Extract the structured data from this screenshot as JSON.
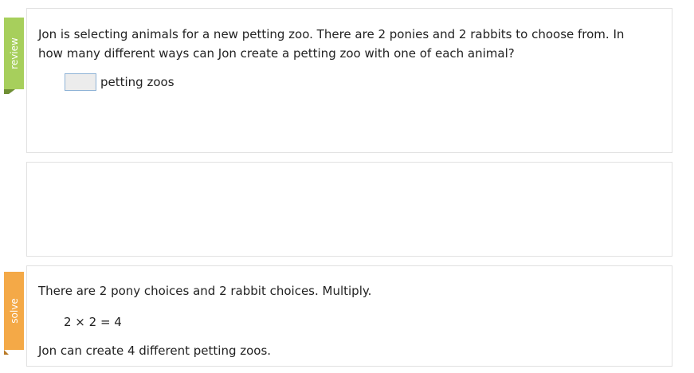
{
  "tabs": {
    "review": {
      "label": "review",
      "color": "#a7cf5c"
    },
    "solve": {
      "label": "solve",
      "color": "#f4a947"
    }
  },
  "review": {
    "question": "Jon is selecting animals for a new petting zoo. There are 2 ponies and 2 rabbits to choose from. In how many different ways can Jon create a petting zoo with one of each animal?",
    "answer_value": "",
    "answer_unit": "petting zoos"
  },
  "solve": {
    "line1": "There are 2 pony choices and 2 rabbit choices. Multiply.",
    "equation": "2 × 2 = 4",
    "line3": "Jon can create 4 different petting zoos."
  }
}
